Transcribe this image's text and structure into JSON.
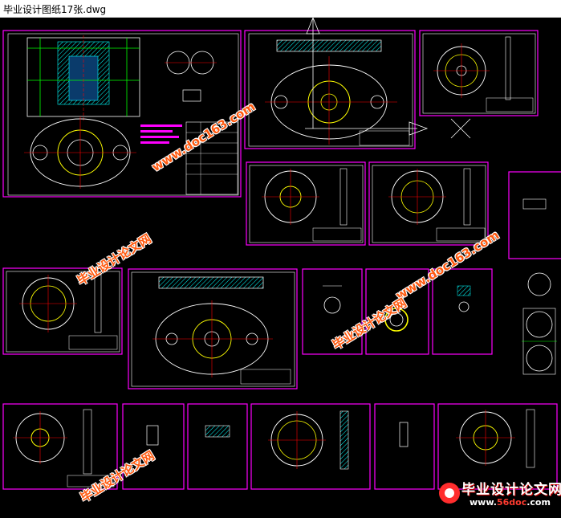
{
  "window": {
    "title": "毕业设计图纸17张.dwg"
  },
  "watermarks": {
    "site_cn": "毕业设计论文网",
    "site_url": "www.doc163.com"
  },
  "logo": {
    "cn": "毕业设计论文网",
    "url_prefix": "www.",
    "url_brand": "56doc",
    "url_suffix": ".com"
  },
  "colors": {
    "background": "#000000",
    "frame": "#ff00ff",
    "line": "#ffffff",
    "circle": "#ffff00",
    "center": "#ff0000",
    "dim": "#00ff00",
    "hatch": "#00ffff"
  }
}
